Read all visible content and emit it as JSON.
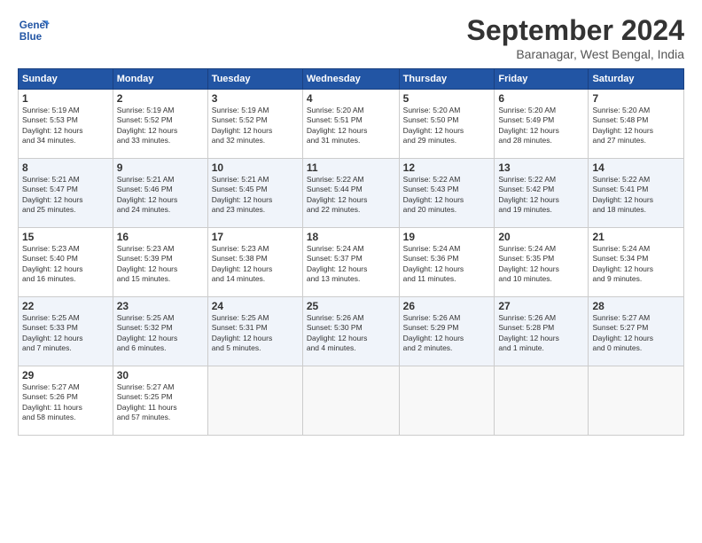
{
  "header": {
    "logo_line1": "General",
    "logo_line2": "Blue",
    "title": "September 2024",
    "subtitle": "Baranagar, West Bengal, India"
  },
  "days_of_week": [
    "Sunday",
    "Monday",
    "Tuesday",
    "Wednesday",
    "Thursday",
    "Friday",
    "Saturday"
  ],
  "weeks": [
    [
      {
        "day": "1",
        "lines": [
          "Sunrise: 5:19 AM",
          "Sunset: 5:53 PM",
          "Daylight: 12 hours",
          "and 34 minutes."
        ]
      },
      {
        "day": "2",
        "lines": [
          "Sunrise: 5:19 AM",
          "Sunset: 5:52 PM",
          "Daylight: 12 hours",
          "and 33 minutes."
        ]
      },
      {
        "day": "3",
        "lines": [
          "Sunrise: 5:19 AM",
          "Sunset: 5:52 PM",
          "Daylight: 12 hours",
          "and 32 minutes."
        ]
      },
      {
        "day": "4",
        "lines": [
          "Sunrise: 5:20 AM",
          "Sunset: 5:51 PM",
          "Daylight: 12 hours",
          "and 31 minutes."
        ]
      },
      {
        "day": "5",
        "lines": [
          "Sunrise: 5:20 AM",
          "Sunset: 5:50 PM",
          "Daylight: 12 hours",
          "and 29 minutes."
        ]
      },
      {
        "day": "6",
        "lines": [
          "Sunrise: 5:20 AM",
          "Sunset: 5:49 PM",
          "Daylight: 12 hours",
          "and 28 minutes."
        ]
      },
      {
        "day": "7",
        "lines": [
          "Sunrise: 5:20 AM",
          "Sunset: 5:48 PM",
          "Daylight: 12 hours",
          "and 27 minutes."
        ]
      }
    ],
    [
      {
        "day": "8",
        "lines": [
          "Sunrise: 5:21 AM",
          "Sunset: 5:47 PM",
          "Daylight: 12 hours",
          "and 25 minutes."
        ]
      },
      {
        "day": "9",
        "lines": [
          "Sunrise: 5:21 AM",
          "Sunset: 5:46 PM",
          "Daylight: 12 hours",
          "and 24 minutes."
        ]
      },
      {
        "day": "10",
        "lines": [
          "Sunrise: 5:21 AM",
          "Sunset: 5:45 PM",
          "Daylight: 12 hours",
          "and 23 minutes."
        ]
      },
      {
        "day": "11",
        "lines": [
          "Sunrise: 5:22 AM",
          "Sunset: 5:44 PM",
          "Daylight: 12 hours",
          "and 22 minutes."
        ]
      },
      {
        "day": "12",
        "lines": [
          "Sunrise: 5:22 AM",
          "Sunset: 5:43 PM",
          "Daylight: 12 hours",
          "and 20 minutes."
        ]
      },
      {
        "day": "13",
        "lines": [
          "Sunrise: 5:22 AM",
          "Sunset: 5:42 PM",
          "Daylight: 12 hours",
          "and 19 minutes."
        ]
      },
      {
        "day": "14",
        "lines": [
          "Sunrise: 5:22 AM",
          "Sunset: 5:41 PM",
          "Daylight: 12 hours",
          "and 18 minutes."
        ]
      }
    ],
    [
      {
        "day": "15",
        "lines": [
          "Sunrise: 5:23 AM",
          "Sunset: 5:40 PM",
          "Daylight: 12 hours",
          "and 16 minutes."
        ]
      },
      {
        "day": "16",
        "lines": [
          "Sunrise: 5:23 AM",
          "Sunset: 5:39 PM",
          "Daylight: 12 hours",
          "and 15 minutes."
        ]
      },
      {
        "day": "17",
        "lines": [
          "Sunrise: 5:23 AM",
          "Sunset: 5:38 PM",
          "Daylight: 12 hours",
          "and 14 minutes."
        ]
      },
      {
        "day": "18",
        "lines": [
          "Sunrise: 5:24 AM",
          "Sunset: 5:37 PM",
          "Daylight: 12 hours",
          "and 13 minutes."
        ]
      },
      {
        "day": "19",
        "lines": [
          "Sunrise: 5:24 AM",
          "Sunset: 5:36 PM",
          "Daylight: 12 hours",
          "and 11 minutes."
        ]
      },
      {
        "day": "20",
        "lines": [
          "Sunrise: 5:24 AM",
          "Sunset: 5:35 PM",
          "Daylight: 12 hours",
          "and 10 minutes."
        ]
      },
      {
        "day": "21",
        "lines": [
          "Sunrise: 5:24 AM",
          "Sunset: 5:34 PM",
          "Daylight: 12 hours",
          "and 9 minutes."
        ]
      }
    ],
    [
      {
        "day": "22",
        "lines": [
          "Sunrise: 5:25 AM",
          "Sunset: 5:33 PM",
          "Daylight: 12 hours",
          "and 7 minutes."
        ]
      },
      {
        "day": "23",
        "lines": [
          "Sunrise: 5:25 AM",
          "Sunset: 5:32 PM",
          "Daylight: 12 hours",
          "and 6 minutes."
        ]
      },
      {
        "day": "24",
        "lines": [
          "Sunrise: 5:25 AM",
          "Sunset: 5:31 PM",
          "Daylight: 12 hours",
          "and 5 minutes."
        ]
      },
      {
        "day": "25",
        "lines": [
          "Sunrise: 5:26 AM",
          "Sunset: 5:30 PM",
          "Daylight: 12 hours",
          "and 4 minutes."
        ]
      },
      {
        "day": "26",
        "lines": [
          "Sunrise: 5:26 AM",
          "Sunset: 5:29 PM",
          "Daylight: 12 hours",
          "and 2 minutes."
        ]
      },
      {
        "day": "27",
        "lines": [
          "Sunrise: 5:26 AM",
          "Sunset: 5:28 PM",
          "Daylight: 12 hours",
          "and 1 minute."
        ]
      },
      {
        "day": "28",
        "lines": [
          "Sunrise: 5:27 AM",
          "Sunset: 5:27 PM",
          "Daylight: 12 hours",
          "and 0 minutes."
        ]
      }
    ],
    [
      {
        "day": "29",
        "lines": [
          "Sunrise: 5:27 AM",
          "Sunset: 5:26 PM",
          "Daylight: 11 hours",
          "and 58 minutes."
        ]
      },
      {
        "day": "30",
        "lines": [
          "Sunrise: 5:27 AM",
          "Sunset: 5:25 PM",
          "Daylight: 11 hours",
          "and 57 minutes."
        ]
      },
      {
        "day": "",
        "lines": []
      },
      {
        "day": "",
        "lines": []
      },
      {
        "day": "",
        "lines": []
      },
      {
        "day": "",
        "lines": []
      },
      {
        "day": "",
        "lines": []
      }
    ]
  ]
}
